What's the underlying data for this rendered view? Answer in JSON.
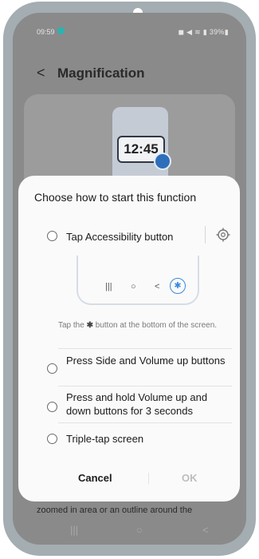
{
  "status_bar": {
    "time": "09:59",
    "right": "◼ ◀ ≋ ▮ 39%▮"
  },
  "header": {
    "back_glyph": "<",
    "title": "Magnification"
  },
  "illustration": {
    "clock": "12:45"
  },
  "background": {
    "partial_text": "zoomed in area or an outline around the"
  },
  "dialog": {
    "title": "Choose how to start this function",
    "options": [
      {
        "label": "Tap Accessibility button"
      },
      {
        "label": "Press Side and Volume up buttons"
      },
      {
        "label": "Press and hold Volume up and down buttons for 3 seconds"
      },
      {
        "label": "Triple-tap screen"
      }
    ],
    "hint_prefix": "Tap the",
    "hint_suffix": "button at the bottom of the screen.",
    "cancel": "Cancel",
    "ok": "OK"
  },
  "navbar": {
    "recent": "|||",
    "home": "○",
    "back": "<"
  },
  "colors": {
    "accent": "#3a8ae0",
    "dim_overlay": "#8a8a8a"
  }
}
